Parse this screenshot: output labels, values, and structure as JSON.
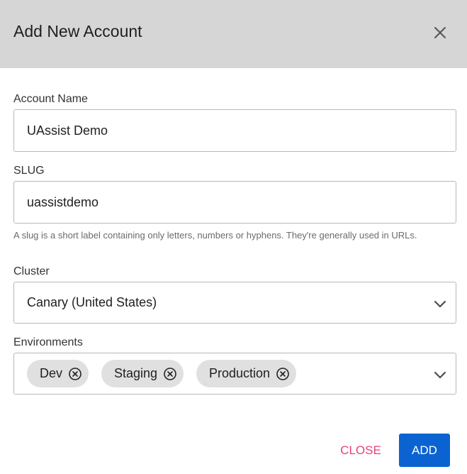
{
  "dialog": {
    "title": "Add New Account",
    "close_icon": "close-icon"
  },
  "form": {
    "account_name": {
      "label": "Account Name",
      "value": "UAssist Demo"
    },
    "slug": {
      "label": "SLUG",
      "value": "uassistdemo",
      "helper": "A slug is a short label containing only letters, numbers or hyphens. They're generally used in URLs."
    },
    "cluster": {
      "label": "Cluster",
      "selected": "Canary (United States)"
    },
    "environments": {
      "label": "Environments",
      "chips": [
        {
          "label": "Dev"
        },
        {
          "label": "Staging"
        },
        {
          "label": "Production"
        }
      ]
    }
  },
  "actions": {
    "close_label": "CLOSE",
    "add_label": "ADD"
  },
  "colors": {
    "header_bg": "#d6d6d6",
    "primary": "#0a63d1",
    "secondary_text": "#e8407a",
    "chip_bg": "#e0e0e0"
  }
}
